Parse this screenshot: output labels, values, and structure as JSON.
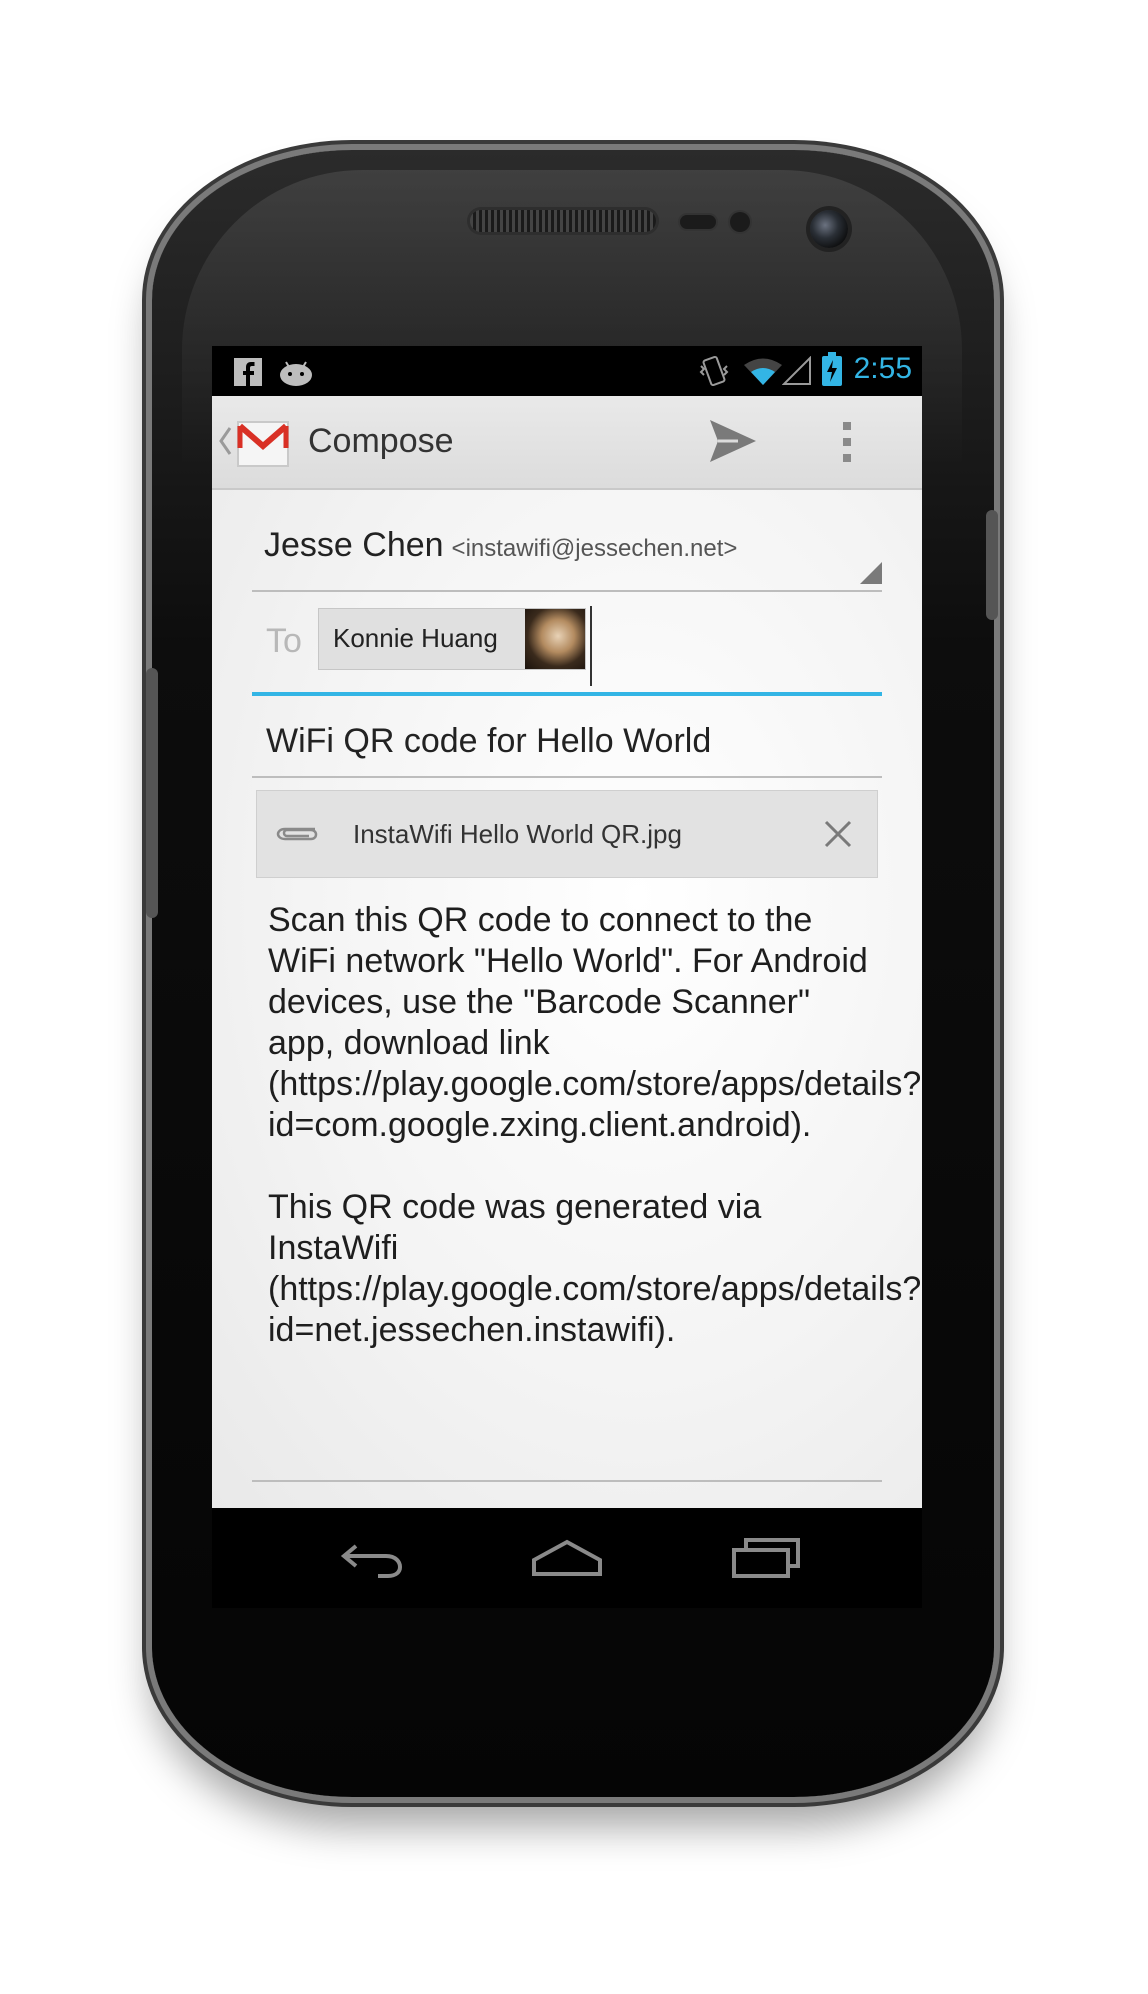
{
  "status_bar": {
    "time": "2:55",
    "icons": [
      "facebook-icon",
      "android-debug-icon",
      "vibrate-icon",
      "wifi-icon",
      "signal-icon",
      "battery-charging-icon"
    ]
  },
  "action_bar": {
    "title": "Compose",
    "app_icon": "gmail-icon",
    "actions": [
      "send-icon",
      "overflow-menu-icon"
    ]
  },
  "compose": {
    "from_name": "Jesse Chen",
    "from_email": "<instawifi@jessechen.net>",
    "to_label": "To",
    "recipient_chip": "Konnie Huang",
    "subject": "WiFi QR code for Hello World",
    "attachment_name": "InstaWifi Hello World QR.jpg",
    "body_paragraph_1": "Scan this QR code to connect to the WiFi network \"Hello World\". For Android devices, use the \"Barcode Scanner\" app, download link (https://play.google.com/store/apps/details?id=com.google.zxing.client.android).",
    "body_paragraph_2": "This QR code was generated via InstaWifi (https://play.google.com/store/apps/details?id=net.jessechen.instawifi)."
  },
  "nav_bar": {
    "buttons": [
      "back-icon",
      "home-icon",
      "recent-apps-icon"
    ]
  },
  "colors": {
    "accent": "#33b5e5",
    "gmail_red": "#d93025",
    "action_bar_bg": "#e4e4e4"
  }
}
